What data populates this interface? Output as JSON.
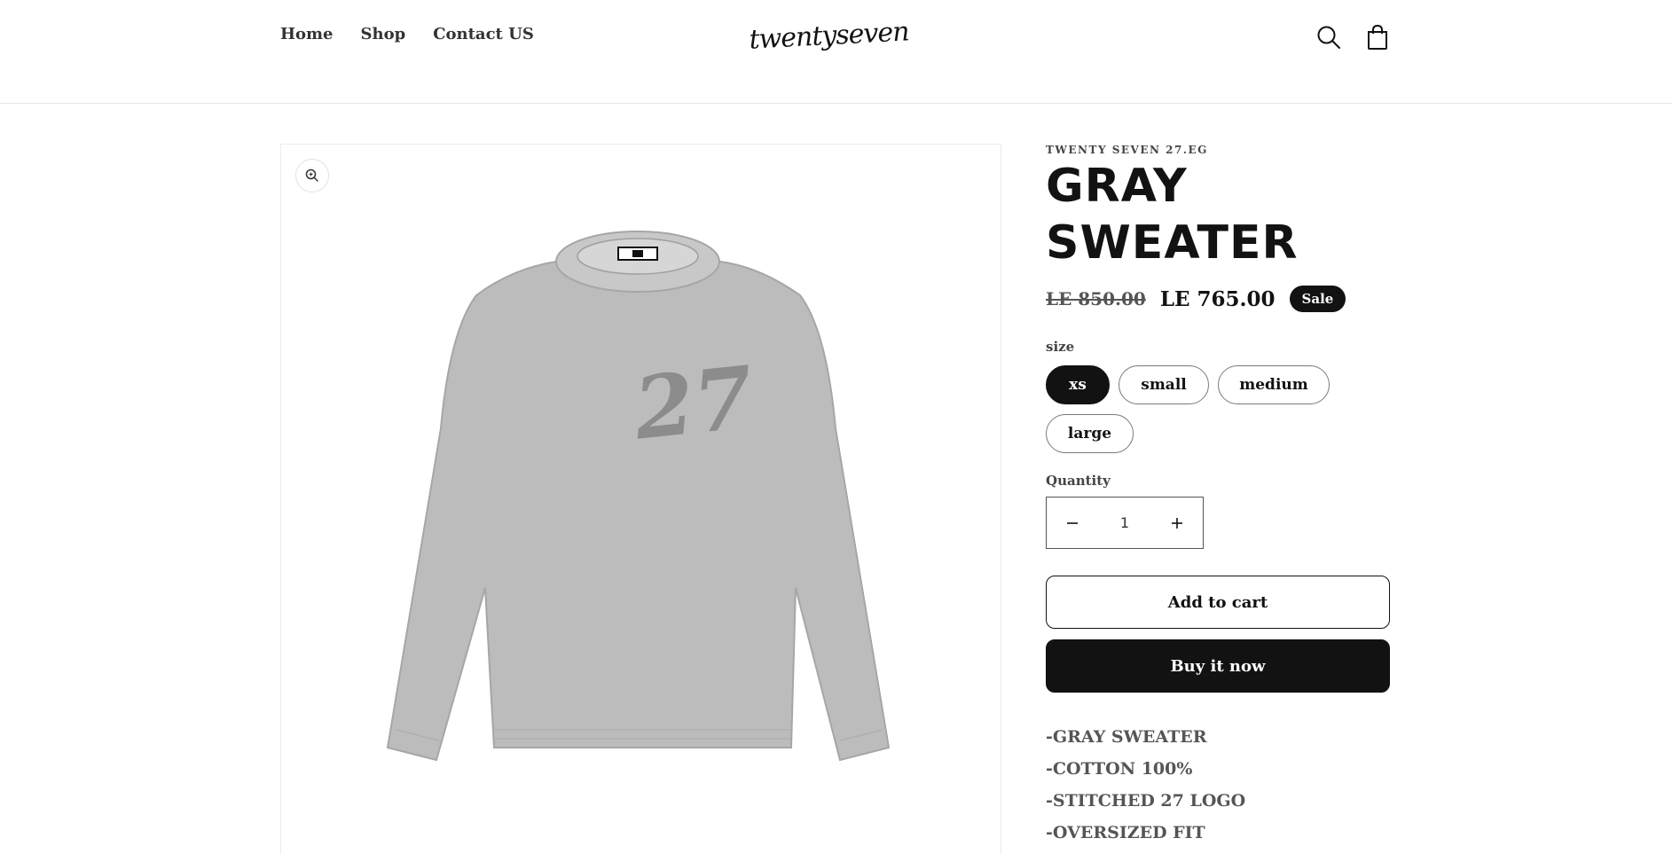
{
  "header": {
    "nav": [
      "Home",
      "Shop",
      "Contact US"
    ],
    "logo_text": "twentyseven",
    "icons": [
      "search-icon",
      "cart-icon"
    ]
  },
  "gallery": {
    "zoom_icon": "zoom-in-icon",
    "image_alt": "gray sweater",
    "image_mark": "27"
  },
  "product": {
    "vendor": "TWENTY SEVEN 27.EG",
    "title": "GRAY SWEATER",
    "price_old": "LE 850.00",
    "price_new": "LE 765.00",
    "badge": "Sale",
    "size_label": "size",
    "sizes": [
      "xs",
      "small",
      "medium",
      "large"
    ],
    "selected_size": "xs",
    "quantity_label": "Quantity",
    "quantity": "1",
    "add_to_cart": "Add to cart",
    "buy_now": "Buy it now",
    "description": [
      "-GRAY SWEATER",
      "-COTTON 100%",
      "-STITCHED 27 LOGO",
      "-OVERSIZED FIT"
    ]
  },
  "colors": {
    "primary": "#121212",
    "background": "#ffffff",
    "sweater": "#b9b9b9"
  }
}
